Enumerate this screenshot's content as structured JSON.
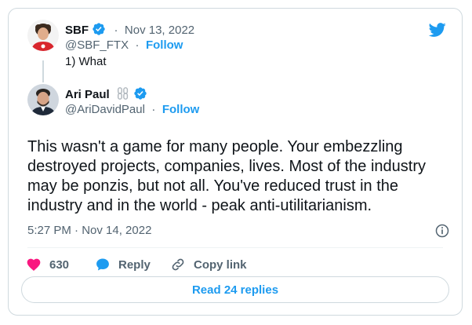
{
  "colors": {
    "accent": "#1d9bf0",
    "like": "#f91880",
    "text": "#0f1419",
    "muted": "#536471",
    "border": "#cfd9de"
  },
  "quoted_tweet": {
    "display_name": "SBF",
    "date": "Nov 13, 2022",
    "handle": "@SBF_FTX",
    "follow_label": "Follow",
    "text": "1) What",
    "avatar_icon": "avatar-image"
  },
  "tweet": {
    "display_name": "Ari Paul",
    "name_emoji_icon": "chain-link-icon",
    "handle": "@AriDavidPaul",
    "follow_label": "Follow",
    "text": "This wasn't a game for many people.  Your embezzling destroyed projects, companies, lives.  Most of the industry may be ponzis, but not all.  You've reduced trust in the industry and in the world - peak anti-utilitarianism.",
    "timestamp": "5:27 PM · Nov 14, 2022",
    "avatar_icon": "avatar-image"
  },
  "actions": {
    "likes_count": "630",
    "reply_label": "Reply",
    "copy_link_label": "Copy link"
  },
  "read_replies_label": "Read 24 replies",
  "separator": "·"
}
